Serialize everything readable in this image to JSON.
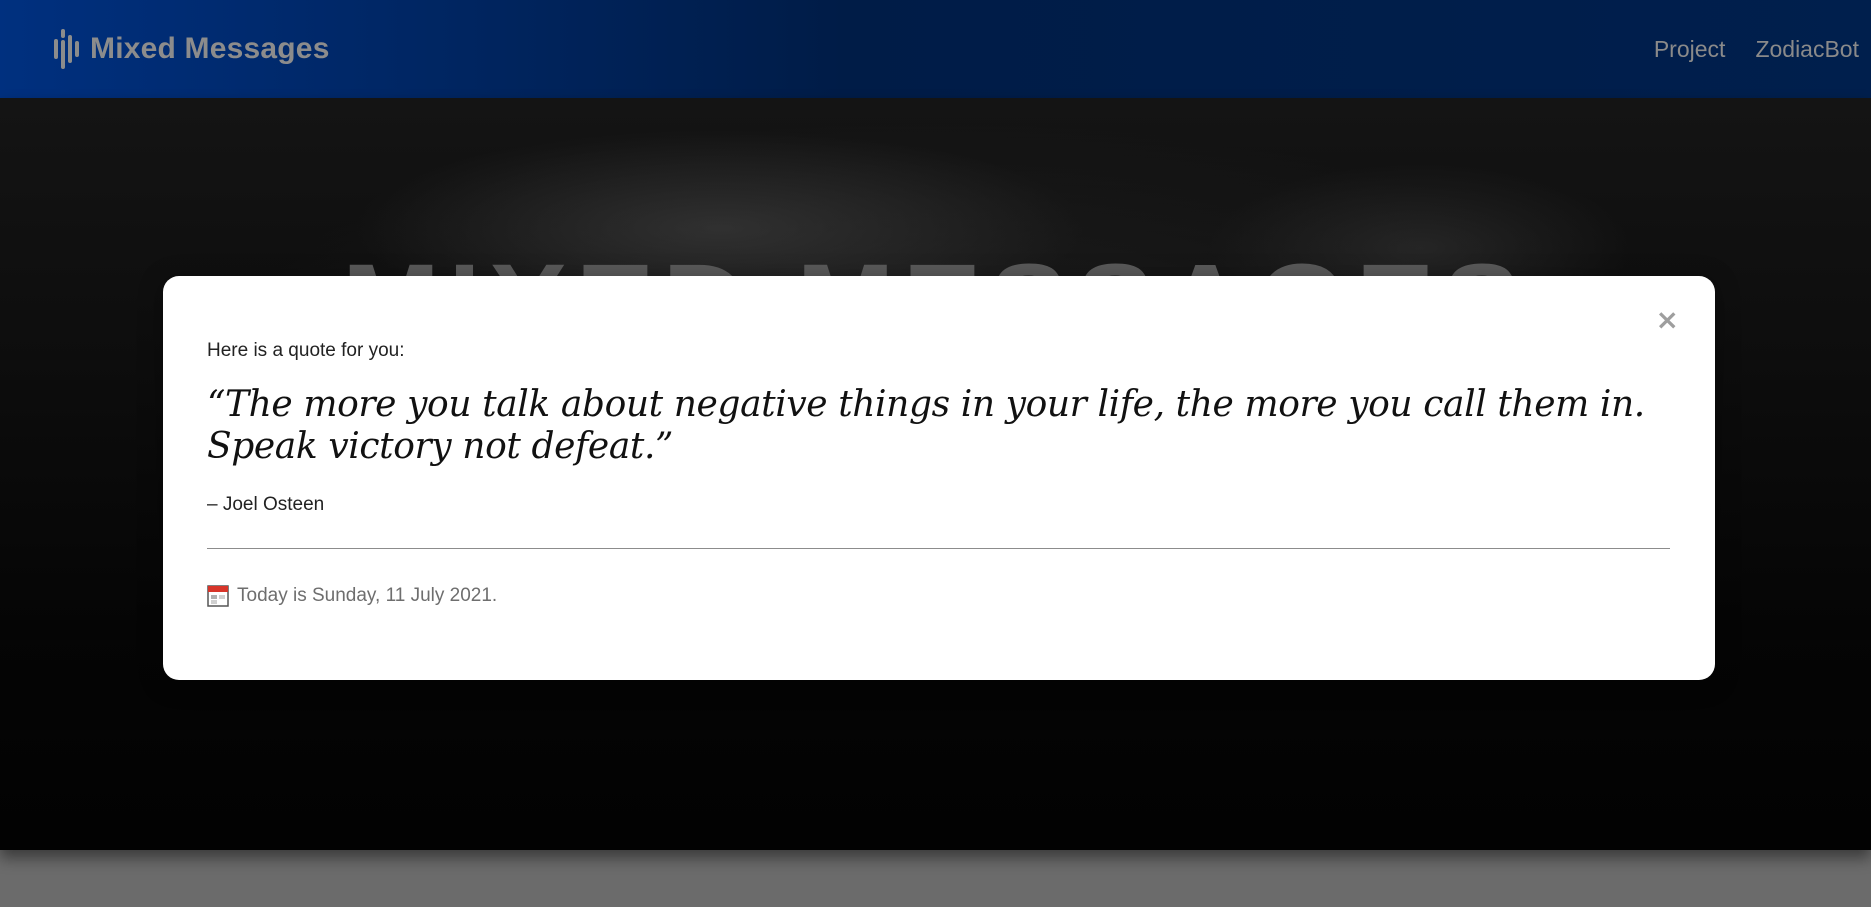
{
  "navbar": {
    "brand": "Mixed Messages",
    "brand_icon": "audio-bars-icon",
    "links": [
      "Project",
      "ZodiacBot"
    ]
  },
  "hero": {
    "title": "MIXED MESSAGES"
  },
  "modal": {
    "close_label": "×",
    "intro": "Here is a quote for you:",
    "quote": "“The more you talk about negative things in your life, the more you call them in. Speak victory not defeat.”",
    "author": "– Joel Osteen",
    "date_icon": "calendar-icon",
    "date_text": "Today is Sunday, 11 July 2021."
  },
  "colors": {
    "navbar": "#001c47",
    "modal_bg": "#ffffff",
    "hero_bg": "#0a0a0a"
  }
}
